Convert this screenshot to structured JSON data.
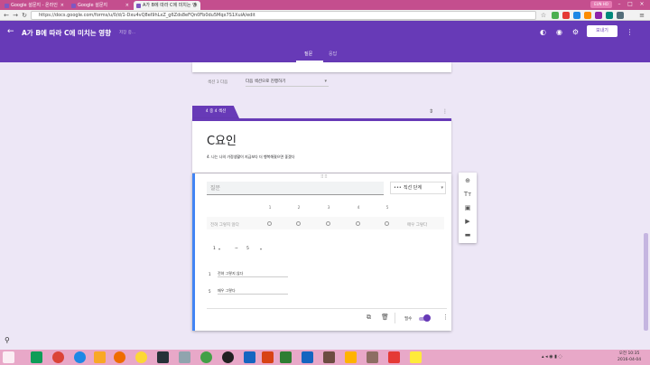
{
  "browser": {
    "tabs": [
      {
        "label": "Google 설문지 - 온라인"
      },
      {
        "label": "Google 설문지"
      },
      {
        "label": "A가 B에 따라 C에 미치는 영"
      }
    ],
    "user_badge": "EUN HO",
    "url": "https://docs.google.com/forms/u/0/d/1-Dxu4vQ8eI9hLxZ_g6Zds8eFQn0Fb0du5Mqx7S1XuiA/edit"
  },
  "form_header": {
    "title": "A가 B에 따라 C에 미치는 영향",
    "save_status": "저장 중...",
    "send_label": "보내기",
    "tabs": [
      {
        "label": "질문"
      },
      {
        "label": "응답"
      }
    ]
  },
  "after_section": {
    "label": "섹션 3 다음",
    "value": "다음 섹션으로 진행하기"
  },
  "section": {
    "tab_label": "4 중 4 섹션",
    "title": "C요인",
    "description": "4. 나는 나의 가정생활이 지금보다 더 행복해졌으면 좋겠다"
  },
  "question": {
    "title_placeholder": "질문",
    "type_label": "직선 단계",
    "scale_numbers": [
      "1",
      "2",
      "3",
      "4",
      "5"
    ],
    "min_label_preview": "전혀 그렇지 않다",
    "max_label_preview": "매우 그렇다",
    "range_from": "1",
    "range_sep": "~",
    "range_to": "5",
    "label_rows": [
      {
        "num": "1",
        "text": "전혀 그렇지 않다"
      },
      {
        "num": "5",
        "text": "매우 그렇다"
      }
    ],
    "required_label": "필수"
  },
  "taskbar": {
    "clock_time": "오전 10:35",
    "clock_date": "2016-04-04"
  },
  "colors": {
    "primary": "#673ab7",
    "accent_blue": "#4285f4",
    "background": "#ede7f6"
  }
}
